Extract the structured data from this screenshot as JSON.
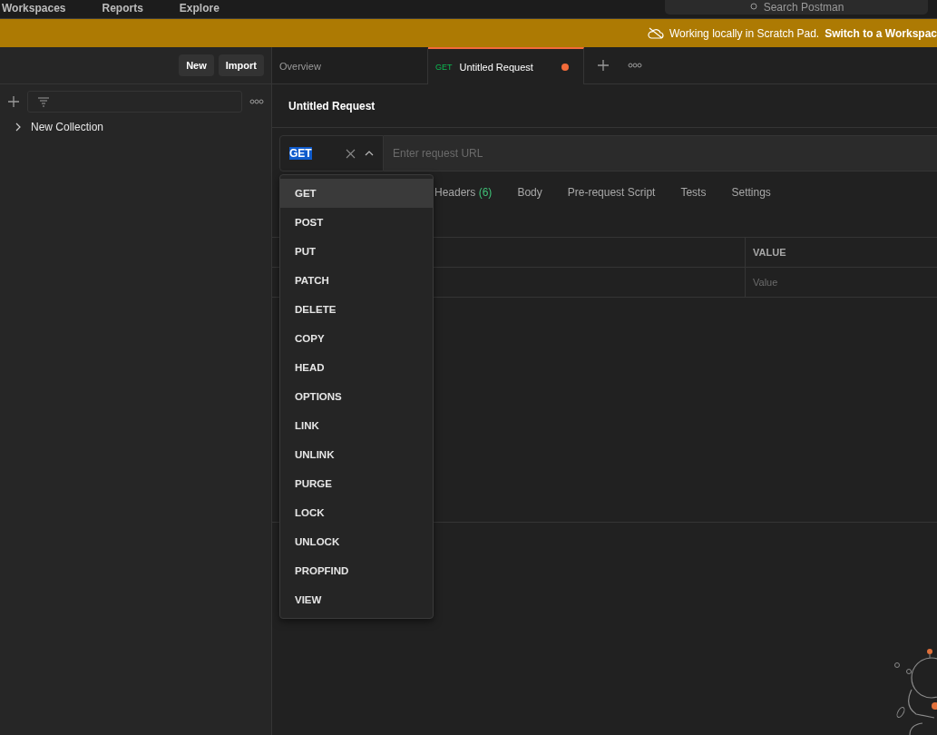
{
  "top_nav": {
    "items": [
      "Workspaces",
      "Reports",
      "Explore"
    ],
    "search": {
      "placeholder": "Search Postman"
    }
  },
  "banner": {
    "message": "Working locally in Scratch Pad.",
    "link": "Switch to a Workspac"
  },
  "sidebar": {
    "buttons": [
      "New",
      "Import"
    ],
    "collections": [
      {
        "name": "New Collection",
        "expanded": false
      }
    ]
  },
  "tabs": [
    {
      "label": "Overview",
      "selected": false,
      "unsaved": false
    },
    {
      "method": "GET",
      "label": "Untitled Request",
      "selected": true,
      "unsaved": true
    }
  ],
  "request": {
    "title": "Untitled Request",
    "method": "GET",
    "url_placeholder": "Enter request URL"
  },
  "method_menu": {
    "open": true,
    "items": [
      {
        "label": "GET",
        "selected": true
      },
      {
        "label": "POST",
        "selected": false
      },
      {
        "label": "PUT",
        "selected": false
      },
      {
        "label": "PATCH",
        "selected": false
      },
      {
        "label": "DELETE",
        "selected": false
      },
      {
        "label": "COPY",
        "selected": false
      },
      {
        "label": "HEAD",
        "selected": false
      },
      {
        "label": "OPTIONS",
        "selected": false
      },
      {
        "label": "LINK",
        "selected": false
      },
      {
        "label": "UNLINK",
        "selected": false
      },
      {
        "label": "PURGE",
        "selected": false
      },
      {
        "label": "LOCK",
        "selected": false
      },
      {
        "label": "UNLOCK",
        "selected": false
      },
      {
        "label": "PROPFIND",
        "selected": false
      },
      {
        "label": "VIEW",
        "selected": false
      }
    ]
  },
  "request_tabs": [
    {
      "label": "Headers",
      "count": "(6)"
    },
    {
      "label": "Body"
    },
    {
      "label": "Pre-request Script"
    },
    {
      "label": "Tests"
    },
    {
      "label": "Settings"
    }
  ],
  "table": {
    "columns": [
      "VALUE"
    ],
    "rows": [
      {
        "value_placeholder": "Value"
      }
    ]
  }
}
